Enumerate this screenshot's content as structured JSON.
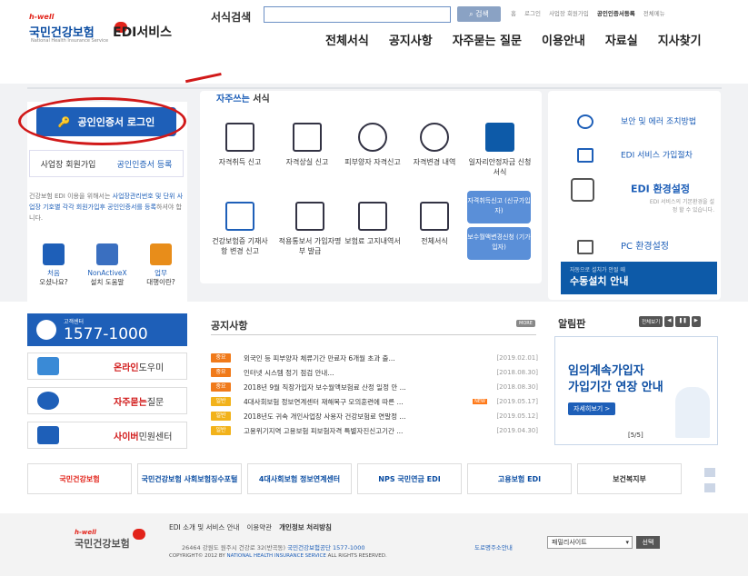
{
  "header": {
    "logo_hwell": "h-well",
    "logo_name": "국민건강보험",
    "logo_sub": "National Health Insurance Service",
    "title": "EDI서비스",
    "search_label": "서식검색",
    "search_value": "",
    "search_button": "검색",
    "util_links": [
      "홈",
      "로그인",
      "사업장 회원가입",
      "공인인증서등록",
      "전체메뉴"
    ],
    "gnb": [
      "전체서식",
      "공지사항",
      "자주묻는 질문",
      "이용안내",
      "자료실",
      "지사찾기"
    ]
  },
  "login": {
    "login_button": "공인인증서 로그인",
    "register_member": "사업장 회원가입",
    "register_cert": "공인인증서 등록",
    "desc_pre": "건강보험 EDI 이용을 위해서는 ",
    "desc_hl1": "사업장관리번호 및 단위 사업장 기호별 각각 회원가입후 공인인증서를 등록",
    "desc_post": "하셔야 합니다.",
    "icons": [
      {
        "label1": "처음",
        "label2": "오셨나요?"
      },
      {
        "label1": "NonActiveX",
        "label2": "설치 도움말"
      },
      {
        "label1": "업무",
        "label2": "대행이란?"
      }
    ]
  },
  "favorites": {
    "title_prefix": "자주쓰는",
    "title_suffix": "서식",
    "row1": [
      "자격취득 신고",
      "자격상실 신고",
      "피부양자 자격신고",
      "자격변경 내역",
      "일자리안정자금 신청서식"
    ],
    "row2": [
      "건강보험증 기재사항 변경 신고",
      "적용통보서 가입자명부 발급",
      "보험료 고지내역서",
      "전체서식"
    ],
    "blue1": "자격취득신고 (신규가입자)",
    "blue2": "보수월액변경신청 (기가입자)"
  },
  "right_panel": {
    "items": [
      {
        "title": "보안 및 에러 조치방법"
      },
      {
        "title": "EDI 서비스 가입절차"
      },
      {
        "title": "EDI 환경설정",
        "desc": "EDI 서비스의 기본환경을 설정 할 수 있습니다."
      },
      {
        "title": "PC 환경설정"
      }
    ],
    "manual_sub": "자동으로 설치가 안될 때",
    "manual_title": "수동설치 안내"
  },
  "callcenter": {
    "label": "고객센터",
    "number": "1577-1000"
  },
  "services": [
    {
      "hl": "온라인",
      "rest": " 도우미"
    },
    {
      "hl": "자주묻는",
      "rest": " 질문"
    },
    {
      "hl": "사이버",
      "rest": " 민원센터"
    }
  ],
  "notice": {
    "title": "공지사항",
    "more": "MORE",
    "items": [
      {
        "badge": "중요",
        "text": "외국인 등 피부양자 체류기간 만료자 6개월 초과 출...",
        "date": "[2019.02.01]",
        "new": ""
      },
      {
        "badge": "중요",
        "text": "인터넷 시스템 정기 점검 안내...",
        "date": "[2018.08.30]",
        "new": ""
      },
      {
        "badge": "중요",
        "text": "2018년 9월 직장가입자 보수월액보험료 산정 일정 안 ...",
        "date": "[2018.08.30]",
        "new": ""
      },
      {
        "badge": "일반",
        "text": "4대사회보험 정보연계센터 재해복구 모의훈련에 따른 ...",
        "date": "[2019.05.17]",
        "new": "NEW"
      },
      {
        "badge": "일반",
        "text": "2018년도 귀속 개인사업장 사용자 건강보험료 연말정 ...",
        "date": "[2019.05.12]",
        "new": ""
      },
      {
        "badge": "일반",
        "text": "고용위기지역 고용보험 피보험자격 특별자진신고기간 ...",
        "date": "[2019.04.30]",
        "new": ""
      }
    ]
  },
  "alarm": {
    "title": "알림판",
    "view_all": "전체보기",
    "headline1": "임의계속가입자",
    "headline2": "가입기간 연장 안내",
    "detail": "자세히보기 >",
    "page": "[5/5]"
  },
  "partners": [
    "국민건강보험",
    "국민건강보험 사회보험징수포털",
    "4대사회보험 정보연계센터",
    "NPS 국민연금 EDI",
    "고용보험 EDI",
    "보건복지부"
  ],
  "footer": {
    "logo_hwell": "h-well",
    "logo_name": "국민건강보험",
    "links": [
      "EDI 소개 및 서비스 안내",
      "이용약관",
      "개인정보 처리방침"
    ],
    "addr_pre": "26464  강원도 원주시 건강로 32(반곡동)   ",
    "addr_hl": "국민건강보험공단 1577-1000",
    "copy_pre": "COPYRIGHT© 2012 BY ",
    "copy_hl": "NATIONAL HEALTH INSURANCE SERVICE",
    "copy_post": " ALL RIGHTS RESERVED.",
    "road": "도로명주소안내",
    "family_site": "패밀리사이트",
    "go": "선택"
  }
}
